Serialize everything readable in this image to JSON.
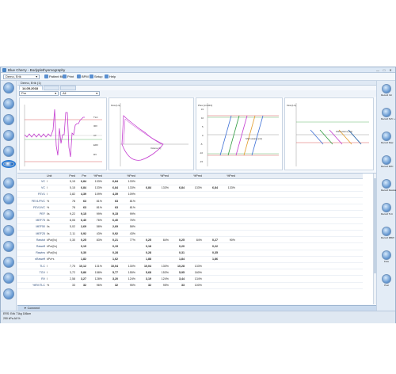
{
  "window": {
    "title": "Blue Cherry - Bodyplethysmography",
    "controls": [
      "—",
      "□",
      "✕"
    ]
  },
  "toolbar": {
    "patient_combo": "Demo, Erik",
    "items": [
      {
        "label": "Patient file",
        "icon": "folder-icon"
      },
      {
        "label": "Print",
        "icon": "print-icon"
      },
      {
        "label": "BPM",
        "icon": "bpm-icon"
      },
      {
        "label": "Setup",
        "icon": "gear-icon"
      },
      {
        "label": "Help",
        "icon": "help-icon"
      }
    ]
  },
  "study": {
    "bar_label": "Demo, Erik (1)",
    "tabs": [
      "14.05.2018",
      "",
      ""
    ],
    "select_left": "Pre",
    "select_right": "All"
  },
  "graphs": {
    "tidal_ticks_right": [
      "TLC",
      "IRV",
      "VT",
      "ERV",
      "RV"
    ],
    "flow_volume_xlabel": "Volume [L]",
    "flow_volume_ylabel": "Flow [L/s]",
    "shift_volume_label": "Shift volume [ml]",
    "shift_volume_yticks": [
      "15",
      "10",
      "5",
      "0",
      "-5",
      "-10",
      "-15"
    ],
    "shift_volume_ylabel": "Pbox [cmH2O]",
    "resistance_label": "Shift volume [ml]",
    "resistance_ylabel": "Flow [L/s]"
  },
  "table": {
    "headers": [
      "",
      "Unit",
      "Pred",
      "Pre",
      "%Pred",
      "",
      "%Pred",
      "",
      "%Pred",
      "",
      "%Pred",
      "",
      "%Pred",
      ""
    ],
    "rows": [
      {
        "name": "VC",
        "unit": "l",
        "pred": "5,15",
        "pre": "6,84",
        "pct": "133%",
        "c1": "6,84",
        "c1p": "133%",
        "c2": "",
        "c2p": "",
        "c3": "",
        "c3p": "",
        "c4": "",
        "c4p": ""
      },
      {
        "name": "VC",
        "unit": "l",
        "pred": "5,15",
        "pre": "6,84",
        "pct": "133%",
        "c1": "6,84",
        "c1p": "133%",
        "c2": "6,84",
        "c2p": "133%",
        "c3": "6,84",
        "c3p": "133%",
        "c4": "6,84",
        "c4p": "133%"
      },
      {
        "name": "FEV1",
        "unit": "l",
        "pred": "3,82",
        "pre": "4,39",
        "pct": "109%",
        "c1": "4,39",
        "c1p": "109%",
        "c2": "",
        "c2p": "",
        "c3": "",
        "c3p": "",
        "c4": "",
        "c4p": ""
      },
      {
        "name": "FEV1/FVC",
        "unit": "%",
        "pred": "78",
        "pre": "63",
        "pct": "81%",
        "c1": "63",
        "c1p": "81%",
        "c2": "",
        "c2p": "",
        "c3": "",
        "c3p": "",
        "c4": "",
        "c4p": ""
      },
      {
        "name": "FEV1/VC",
        "unit": "%",
        "pred": "78",
        "pre": "63",
        "pct": "81%",
        "c1": "63",
        "c1p": "81%",
        "c2": "",
        "c2p": "",
        "c3": "",
        "c3p": "",
        "c4": "",
        "c4p": ""
      },
      {
        "name": "PEF",
        "unit": "l/s",
        "pred": "9,22",
        "pre": "9,15",
        "pct": "99%",
        "c1": "9,15",
        "c1p": "99%",
        "c2": "",
        "c2p": "",
        "c3": "",
        "c3p": "",
        "c4": "",
        "c4p": ""
      },
      {
        "name": "MEF75",
        "unit": "l/s",
        "pred": "8,06",
        "pre": "6,40",
        "pct": "76%",
        "c1": "6,40",
        "c1p": "76%",
        "c2": "",
        "c2p": "",
        "c3": "",
        "c3p": "",
        "c4": "",
        "c4p": ""
      },
      {
        "name": "MEF50",
        "unit": "l/s",
        "pred": "5,02",
        "pre": "2,69",
        "pct": "58%",
        "c1": "2,69",
        "c1p": "58%",
        "c2": "",
        "c2p": "",
        "c3": "",
        "c3p": "",
        "c4": "",
        "c4p": ""
      },
      {
        "name": "MEF25",
        "unit": "l/s",
        "pred": "2,11",
        "pre": "0,92",
        "pct": "43%",
        "c1": "0,92",
        "c1p": "43%",
        "c2": "",
        "c2p": "",
        "c3": "",
        "c3p": "",
        "c4": "",
        "c4p": ""
      },
      {
        "name": "Rawtot",
        "unit": "kPa/(l/s)",
        "pred": "0,30",
        "pre": "0,25",
        "pct": "83%",
        "c1": "0,21",
        "c1p": "77%",
        "c2": "0,25",
        "c2p": "84%",
        "c3": "0,25",
        "c3p": "84%",
        "c4": "0,27",
        "c4p": "90%"
      },
      {
        "name": "Raweff",
        "unit": "kPa/(l/s)",
        "pred": "",
        "pre": "0,19",
        "pct": "",
        "c1": "0,19",
        "c1p": "",
        "c2": "0,18",
        "c2p": "",
        "c3": "0,20",
        "c3p": "",
        "c4": "0,22",
        "c4p": ""
      },
      {
        "name": "Rawins",
        "unit": "kPa/(l/s)",
        "pred": "",
        "pre": "0,30",
        "pct": "",
        "c1": "0,28",
        "c1p": "",
        "c2": "0,28",
        "c2p": "",
        "c3": "0,31",
        "c3p": "",
        "c4": "0,35",
        "c4p": ""
      },
      {
        "name": "sRaweff",
        "unit": "kPa*s",
        "pred": "",
        "pre": "1,82",
        "pct": "",
        "c1": "1,62",
        "c1p": "",
        "c2": "1,88",
        "c2p": "",
        "c3": "1,84",
        "c3p": "",
        "c4": "1,86",
        "c4p": ""
      },
      {
        "name": "TLC",
        "unit": "l",
        "pred": "7,75",
        "pre": "10,12",
        "pct": "131%",
        "c1": "10,04",
        "c1p": "130%",
        "c2": "10,04",
        "c2p": "130%",
        "c3": "10,28",
        "c3p": "133%",
        "c4": "",
        "c4p": ""
      },
      {
        "name": "TGV",
        "unit": "l",
        "pred": "3,72",
        "pre": "5,86",
        "pct": "158%",
        "c1": "5,77",
        "c1p": "155%",
        "c2": "5,68",
        "c2p": "153%",
        "c3": "5,95",
        "c3p": "160%",
        "c4": "",
        "c4p": ""
      },
      {
        "name": "RV",
        "unit": "l",
        "pred": "2,58",
        "pre": "3,27",
        "pct": "128%",
        "c1": "3,20",
        "c1p": "124%",
        "c2": "3,19",
        "c2p": "124%",
        "c3": "3,44",
        "c3p": "134%",
        "c4": "",
        "c4p": ""
      },
      {
        "name": "%RV/TLC",
        "unit": "%",
        "pred": "33",
        "pre": "32",
        "pct": "96%",
        "c1": "32",
        "c1p": "95%",
        "c2": "32",
        "c2p": "95%",
        "c3": "33",
        "c3p": "100%",
        "c4": "",
        "c4p": ""
      }
    ]
  },
  "comment_label": "Comment",
  "status": {
    "line1": "ERS: Erik 71kg 186cm",
    "line2": "250 kPa    All %"
  },
  "right_sidebar": [
    {
      "label": "Record Vol"
    },
    {
      "label": "Record SVC + FVC"
    },
    {
      "label": "Record Raw"
    },
    {
      "label": "Record FRC"
    },
    {
      "label": "Record Resistance"
    },
    {
      "label": "Record TLC"
    },
    {
      "label": "Record MBW"
    },
    {
      "label": "Flow"
    },
    {
      "label": "Post"
    }
  ],
  "colors": {
    "accent": "#2b78d4",
    "magenta_curve": "#c43bd0",
    "green_limit": "#3fa64a",
    "red_limit": "#d33434"
  }
}
